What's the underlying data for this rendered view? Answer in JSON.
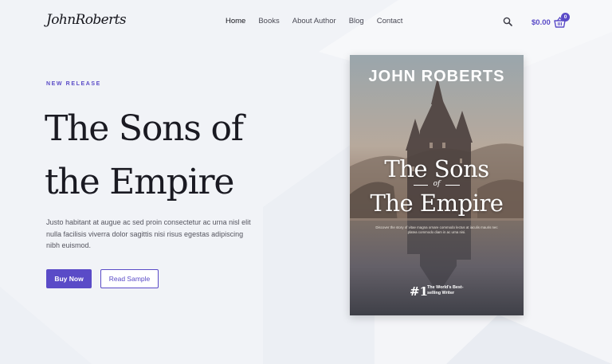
{
  "site": {
    "logo_text": "JohnRoberts"
  },
  "nav": {
    "items": [
      {
        "label": "Home",
        "active": true
      },
      {
        "label": "Books",
        "active": false
      },
      {
        "label": "About Author",
        "active": false
      },
      {
        "label": "Blog",
        "active": false
      },
      {
        "label": "Contact",
        "active": false
      }
    ],
    "search_icon": "search-icon"
  },
  "cart": {
    "total": "$0.00",
    "count": "0",
    "icon": "basket-icon"
  },
  "hero": {
    "eyebrow": "NEW RELEASE",
    "title": "The Sons of the Empire",
    "description": "Justo habitant at augue ac sed proin consectetur ac urna nisl elit nulla facilisis viverra dolor sagittis nisi risus egestas adipiscing nibh euismod.",
    "buttons": {
      "primary": "Buy Now",
      "secondary": "Read Sample"
    }
  },
  "book_cover": {
    "author": "JOHN ROBERTS",
    "title_line_1": "The Sons",
    "title_of": "of",
    "title_line_2": "The Empire",
    "tagline": "Discover the story of vitae magna ornare commodo lectus at iaculis mauris nec platea commodo diam in ac urna nisi.",
    "rank": "#1",
    "rank_label": "The World's Best-selling Writer"
  },
  "colors": {
    "accent": "#5a4bc7",
    "background": "#f1f3f7",
    "heading": "#1a1a22"
  }
}
